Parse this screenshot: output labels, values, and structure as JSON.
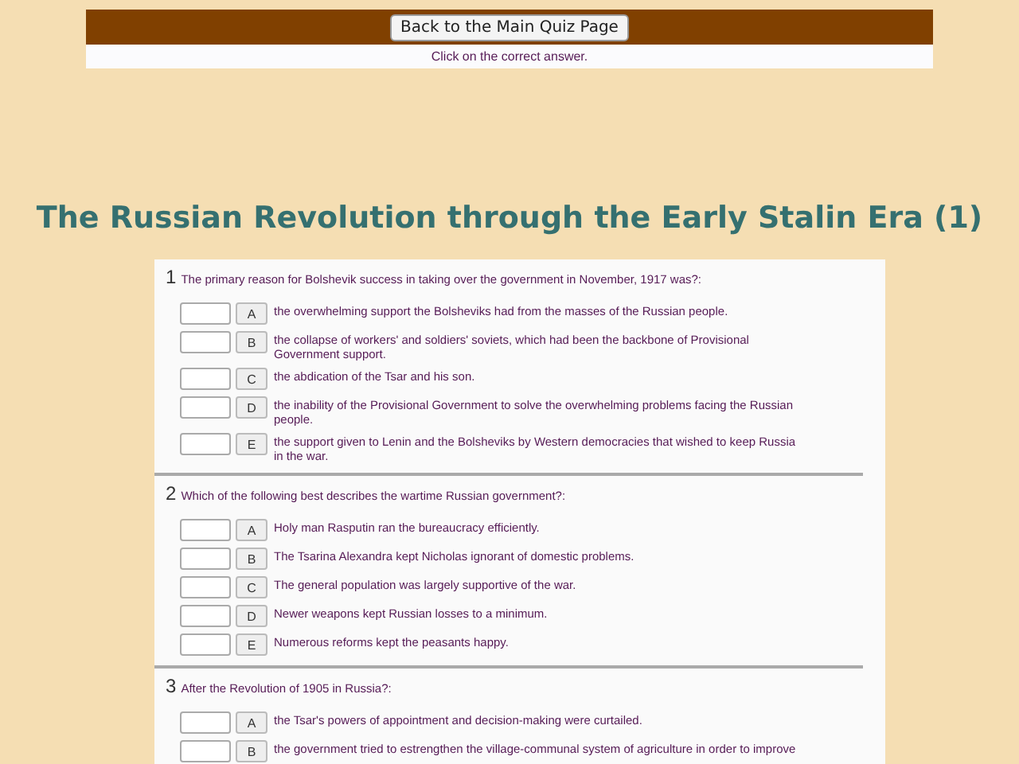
{
  "top_bar": {
    "button": "Back to the Main Quiz Page",
    "instruction": "Click on the correct answer."
  },
  "title": "The Russian Revolution through the Early Stalin Era (1)",
  "questions": [
    {
      "number": "1",
      "text": "The primary reason for Bolshevik success in taking over the government in November, 1917 was?:",
      "options": [
        {
          "letter": "A",
          "text": "the overwhelming support the Bolsheviks had from the masses of the Russian people."
        },
        {
          "letter": "B",
          "text": "the collapse of workers' and soldiers' soviets, which had been the backbone of Provisional Government support."
        },
        {
          "letter": "C",
          "text": "the abdication of the Tsar and his son."
        },
        {
          "letter": "D",
          "text": "the inability of the Provisional Government to solve the overwhelming problems facing the Russian people."
        },
        {
          "letter": "E",
          "text": "the support given to Lenin and the Bolsheviks by Western democracies that wished to keep Russia in the war."
        }
      ]
    },
    {
      "number": "2",
      "text": "Which of the following best describes the wartime Russian government?:",
      "options": [
        {
          "letter": "A",
          "text": "Holy man Rasputin ran the bureaucracy efficiently."
        },
        {
          "letter": "B",
          "text": "The Tsarina Alexandra kept Nicholas ignorant of domestic problems."
        },
        {
          "letter": "C",
          "text": "The general population was largely supportive of the war."
        },
        {
          "letter": "D",
          "text": "Newer weapons kept Russian losses to a minimum."
        },
        {
          "letter": "E",
          "text": "Numerous reforms kept the peasants happy."
        }
      ]
    },
    {
      "number": "3",
      "text": "After the Revolution of 1905 in Russia?:",
      "options": [
        {
          "letter": "A",
          "text": "the Tsar's powers of appointment and decision-making were curtailed."
        },
        {
          "letter": "B",
          "text": "the government tried to estrengthen the village-communal system of agriculture in order to improve"
        }
      ]
    }
  ]
}
